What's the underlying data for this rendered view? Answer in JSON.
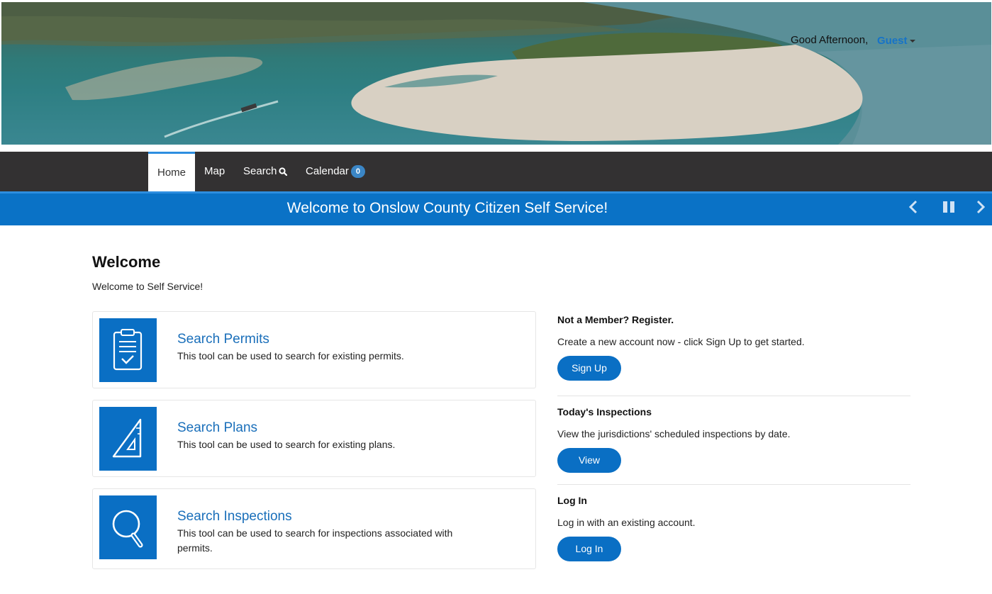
{
  "header": {
    "greeting": "Good Afternoon,",
    "user": "Guest"
  },
  "nav": {
    "home": "Home",
    "map": "Map",
    "search": "Search",
    "calendar": "Calendar",
    "calendar_count": "0"
  },
  "announcement": {
    "text": "Welcome to Onslow County Citizen Self Service!"
  },
  "welcome": {
    "title": "Welcome",
    "subtitle": "Welcome to Self Service!"
  },
  "cards": [
    {
      "title": "Search Permits",
      "description": "This tool can be used to search for existing permits.",
      "icon": "clipboard-check-icon"
    },
    {
      "title": "Search Plans",
      "description": "This tool can be used to search for existing plans.",
      "icon": "set-square-icon"
    },
    {
      "title": "Search Inspections",
      "description": "This tool can be used to search for inspections associated with permits.",
      "icon": "magnifier-icon"
    }
  ],
  "sidebar": {
    "register": {
      "heading": "Not a Member? Register.",
      "text": "Create a new account now - click Sign Up to get started.",
      "button": "Sign Up"
    },
    "inspections": {
      "heading": "Today's Inspections",
      "text": "View the jurisdictions' scheduled inspections by date.",
      "button": "View"
    },
    "login": {
      "heading": "Log In",
      "text": "Log in with an existing account.",
      "button": "Log In"
    }
  },
  "colors": {
    "accent": "#0a72c6",
    "nav_bg": "#333132",
    "link": "#1a6fba"
  }
}
